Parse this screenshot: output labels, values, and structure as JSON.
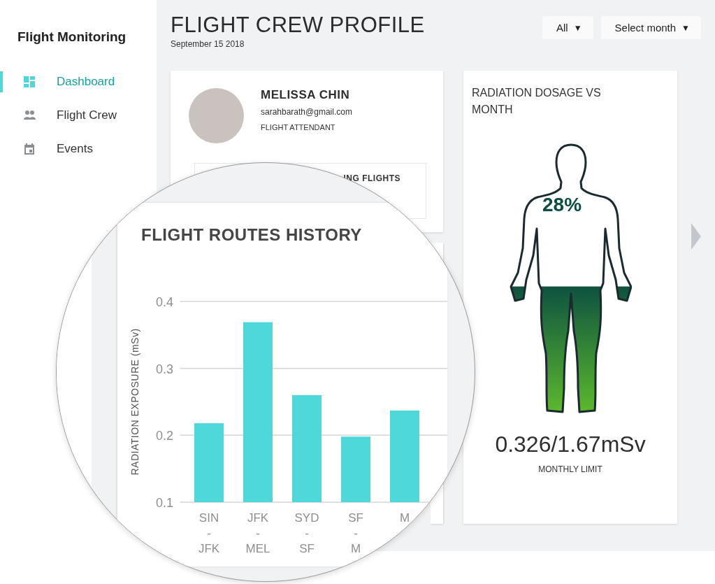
{
  "sidebar": {
    "title": "Flight Monitoring",
    "items": [
      {
        "label": "Dashboard",
        "kind": "dashboard",
        "selected": true
      },
      {
        "label": "Flight Crew",
        "kind": "people",
        "selected": false
      },
      {
        "label": "Events",
        "kind": "calendar",
        "selected": false
      }
    ]
  },
  "header": {
    "title": "FLIGHT CREW PROFILE",
    "date": "September 15 2018",
    "filters": [
      {
        "label": "All",
        "caret": "▼"
      },
      {
        "label": "Select month",
        "caret": "▼"
      }
    ]
  },
  "profile": {
    "name": "MELISSA CHIN",
    "email": "sarahbarath@gmail.com",
    "role": "FLIGHT ATTENDANT",
    "section_title": "ING FLIGHTS"
  },
  "radiation": {
    "title": "RADIATION DOSAGE VS MONTH",
    "percent": "28%",
    "level": 0.47,
    "reading": "0.326/1.67mSv",
    "caption": "MONTHLY LIMIT"
  },
  "magnifier": {
    "chart_data": {
      "type": "bar",
      "title": "FLIGHT ROUTES HISTORY",
      "ylabel": "RADIATION EXPOSURE (mSv)",
      "categories": [
        "SIN - JFK",
        "JFK - MEL",
        "SYD - SF",
        "SF - M",
        "M"
      ],
      "values": [
        0.218,
        0.369,
        0.26,
        0.198,
        0.237
      ],
      "ylim": [
        0.1,
        0.4
      ],
      "yticks": [
        0.1,
        0.2,
        0.3,
        0.4
      ]
    }
  }
}
